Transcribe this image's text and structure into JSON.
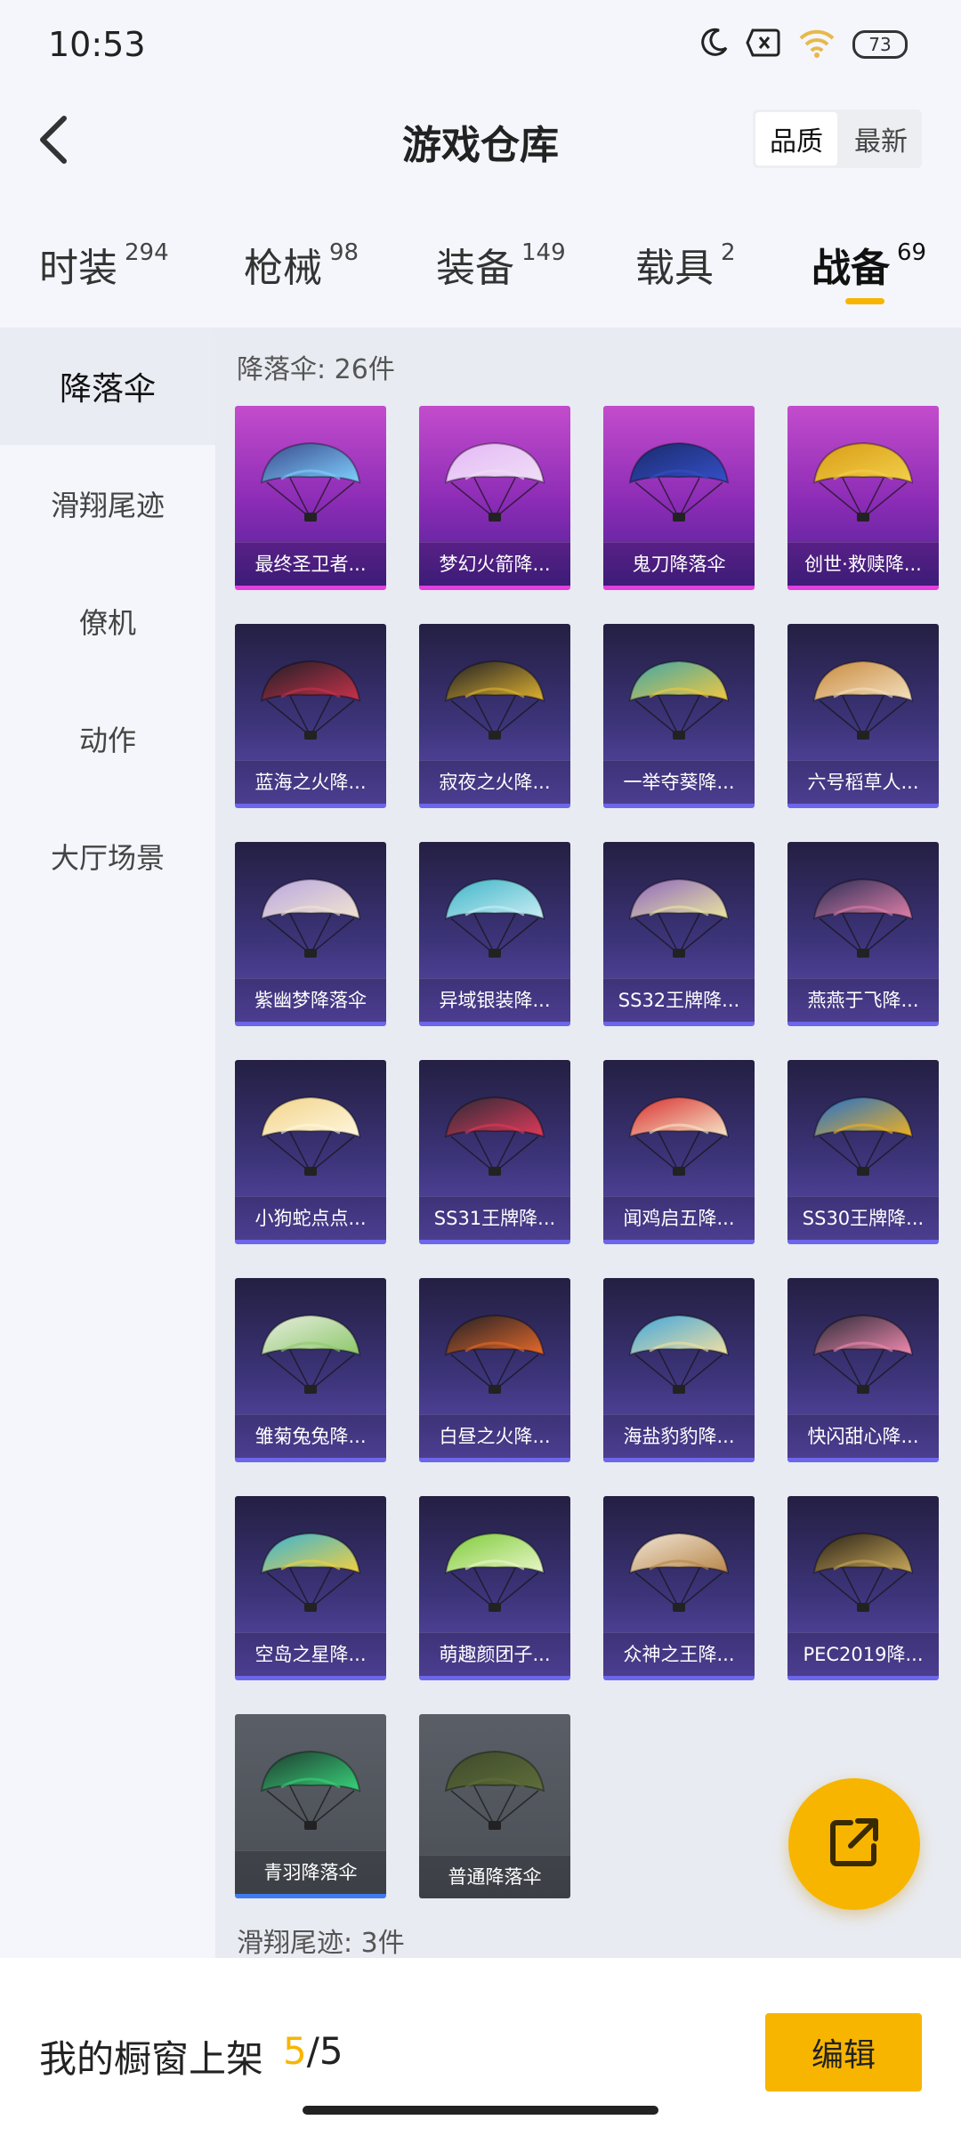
{
  "status": {
    "time": "10:53",
    "battery": "73"
  },
  "header": {
    "title": "游戏仓库",
    "sort_quality": "品质",
    "sort_latest": "最新"
  },
  "tabs": [
    {
      "label": "时装",
      "count": "294"
    },
    {
      "label": "枪械",
      "count": "98"
    },
    {
      "label": "装备",
      "count": "149"
    },
    {
      "label": "载具",
      "count": "2"
    },
    {
      "label": "战备",
      "count": "69"
    }
  ],
  "sidebar": {
    "items": [
      "降落伞",
      "滑翔尾迹",
      "僚机",
      "动作",
      "大厅场景"
    ]
  },
  "section": {
    "parachute_label": "降落伞: 26件",
    "trail_label": "滑翔尾迹: 3件"
  },
  "items": [
    {
      "name": "最终圣卫者...",
      "rarity": "purple",
      "colors": [
        "#3a4a8c",
        "#7fd0ff"
      ]
    },
    {
      "name": "梦幻火箭降...",
      "rarity": "purple",
      "colors": [
        "#e4b8f5",
        "#f0dff7"
      ]
    },
    {
      "name": "鬼刀降落伞",
      "rarity": "purple",
      "colors": [
        "#1a2a6b",
        "#3550c8"
      ]
    },
    {
      "name": "创世·救赎降...",
      "rarity": "purple",
      "colors": [
        "#d99c16",
        "#f3d04a"
      ]
    },
    {
      "name": "蓝海之火降...",
      "rarity": "blue",
      "colors": [
        "#1e1f26",
        "#c9324b"
      ]
    },
    {
      "name": "寂夜之火降...",
      "rarity": "blue",
      "colors": [
        "#1e1f26",
        "#e0b230"
      ]
    },
    {
      "name": "一举夺葵降...",
      "rarity": "blue",
      "colors": [
        "#3fa6a8",
        "#f2c840"
      ]
    },
    {
      "name": "六号稻草人...",
      "rarity": "blue",
      "colors": [
        "#c98a3e",
        "#f3e0c0"
      ]
    },
    {
      "name": "紫幽梦降落伞",
      "rarity": "blue",
      "colors": [
        "#b9a6e0",
        "#f1e4d0"
      ]
    },
    {
      "name": "异域银装降...",
      "rarity": "blue",
      "colors": [
        "#3fb4c8",
        "#c9eef4"
      ]
    },
    {
      "name": "SS32王牌降...",
      "rarity": "blue",
      "colors": [
        "#8e66c0",
        "#e9e6a0"
      ]
    },
    {
      "name": "燕燕于飞降...",
      "rarity": "blue",
      "colors": [
        "#2a2e55",
        "#e07fa8"
      ]
    },
    {
      "name": "小狗蛇点点...",
      "rarity": "blue",
      "colors": [
        "#f2d48a",
        "#fff6de"
      ]
    },
    {
      "name": "SS31王牌降...",
      "rarity": "blue",
      "colors": [
        "#2a2a36",
        "#e03a5a"
      ]
    },
    {
      "name": "闻鸡启五降...",
      "rarity": "blue",
      "colors": [
        "#d92f2f",
        "#f6e6c8"
      ]
    },
    {
      "name": "SS30王牌降...",
      "rarity": "blue",
      "colors": [
        "#1f6fd0",
        "#f0b020"
      ]
    },
    {
      "name": "雏菊兔兔降...",
      "rarity": "blue",
      "colors": [
        "#e8ede0",
        "#8cc86a"
      ]
    },
    {
      "name": "白昼之火降...",
      "rarity": "blue",
      "colors": [
        "#1e1f26",
        "#e86a2a"
      ]
    },
    {
      "name": "海盐豹豹降...",
      "rarity": "blue",
      "colors": [
        "#3fa6e0",
        "#f2e0a0"
      ]
    },
    {
      "name": "快闪甜心降...",
      "rarity": "blue",
      "colors": [
        "#2a2a36",
        "#f28ab0"
      ]
    },
    {
      "name": "空岛之星降...",
      "rarity": "blue",
      "colors": [
        "#37b3d8",
        "#f2d040"
      ]
    },
    {
      "name": "萌趣颜团子...",
      "rarity": "blue",
      "colors": [
        "#7ecb3a",
        "#e9f6c8"
      ]
    },
    {
      "name": "众神之王降...",
      "rarity": "blue",
      "colors": [
        "#f1e6d6",
        "#b8864a"
      ]
    },
    {
      "name": "PEC2019降...",
      "rarity": "blue",
      "colors": [
        "#2a2218",
        "#c9a85a"
      ]
    },
    {
      "name": "青羽降落伞",
      "rarity": "gray",
      "colors": [
        "#1f3a2e",
        "#38d27a"
      ],
      "selected": true
    },
    {
      "name": "普通降落伞",
      "rarity": "gray",
      "colors": [
        "#3e4a2c",
        "#5f6e3a"
      ]
    }
  ],
  "bottom": {
    "showcase_label": "我的橱窗上架",
    "showcase_current": "5",
    "showcase_total": "/5",
    "edit_label": "编辑"
  }
}
